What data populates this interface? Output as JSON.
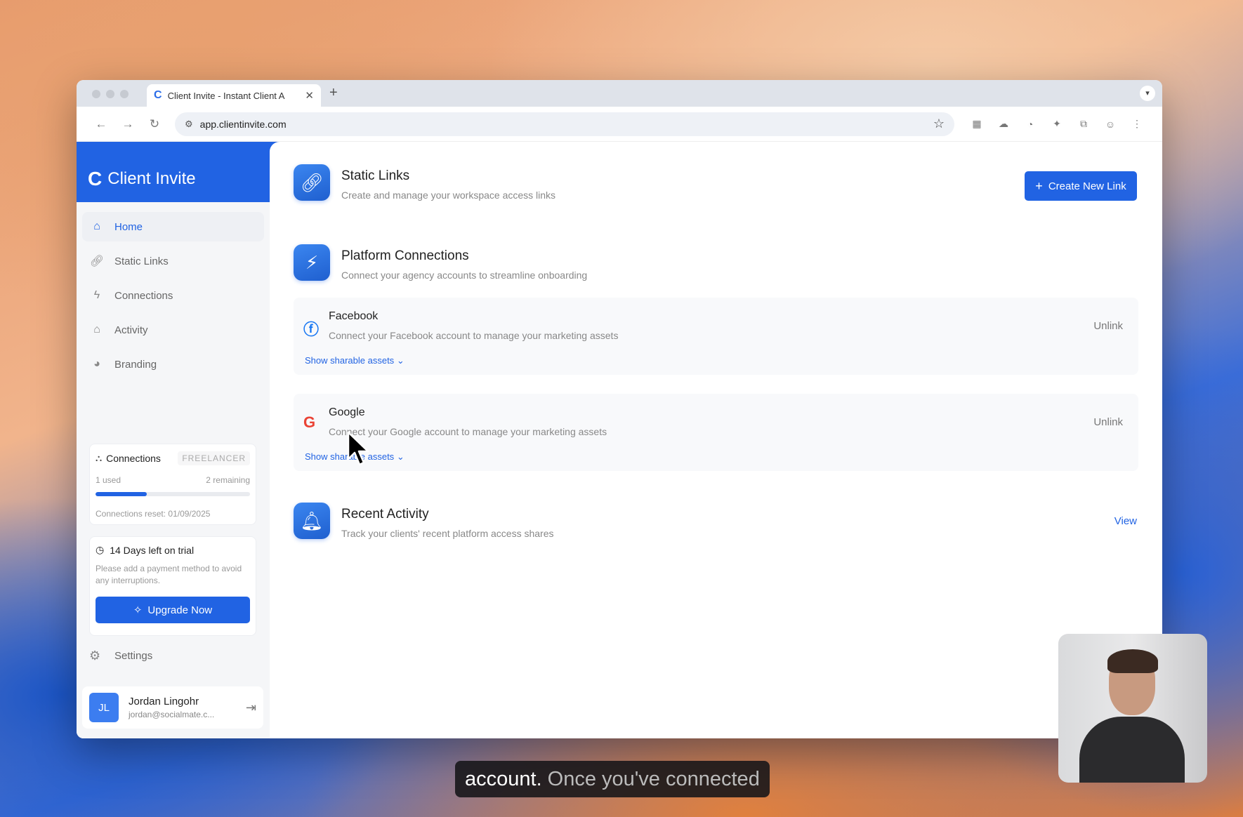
{
  "browser": {
    "tab_title": "Client Invite - Instant Client A",
    "tab_favicon": "C",
    "new_tab": "+",
    "url": "app.clientinvite.com"
  },
  "sidebar": {
    "brand": "Client Invite",
    "nav": [
      {
        "label": "Home",
        "icon": "home-icon",
        "active": true
      },
      {
        "label": "Static Links",
        "icon": "link-icon",
        "active": false
      },
      {
        "label": "Connections",
        "icon": "bolt-icon",
        "active": false
      },
      {
        "label": "Activity",
        "icon": "home-icon",
        "active": false
      },
      {
        "label": "Branding",
        "icon": "palette-icon",
        "active": false
      }
    ],
    "connections_card": {
      "title": "Connections",
      "plan": "FREELANCER",
      "used": "1 used",
      "remaining": "2 remaining",
      "progress": 0.33,
      "reset": "Connections reset: 01/09/2025"
    },
    "trial_card": {
      "title": "14 Days left on trial",
      "text": "Please add a payment method to avoid any interruptions.",
      "button": "Upgrade Now"
    },
    "settings": "Settings",
    "user": {
      "initials": "JL",
      "name": "Jordan Lingohr",
      "email": "jordan@socialmate.c..."
    }
  },
  "main": {
    "static_links": {
      "title": "Static Links",
      "subtitle": "Create and manage your workspace access links",
      "button": "Create New Link"
    },
    "platform_connections": {
      "title": "Platform Connections",
      "subtitle": "Connect your agency accounts to streamline onboarding",
      "platforms": [
        {
          "name": "Facebook",
          "desc": "Connect your Facebook account to manage your marketing assets",
          "action": "Unlink",
          "show": "Show sharable assets",
          "icon": "facebook-icon",
          "color": "#1877f2"
        },
        {
          "name": "Google",
          "desc": "Connect your Google account to manage your marketing assets",
          "action": "Unlink",
          "show": "Show sharable assets",
          "icon": "google-icon",
          "color": "#ea4335"
        }
      ]
    },
    "recent_activity": {
      "title": "Recent Activity",
      "subtitle": "Track your clients' recent platform access shares",
      "link": "View"
    }
  },
  "caption": {
    "bold": "account.",
    "rest": "Once you've connected"
  }
}
